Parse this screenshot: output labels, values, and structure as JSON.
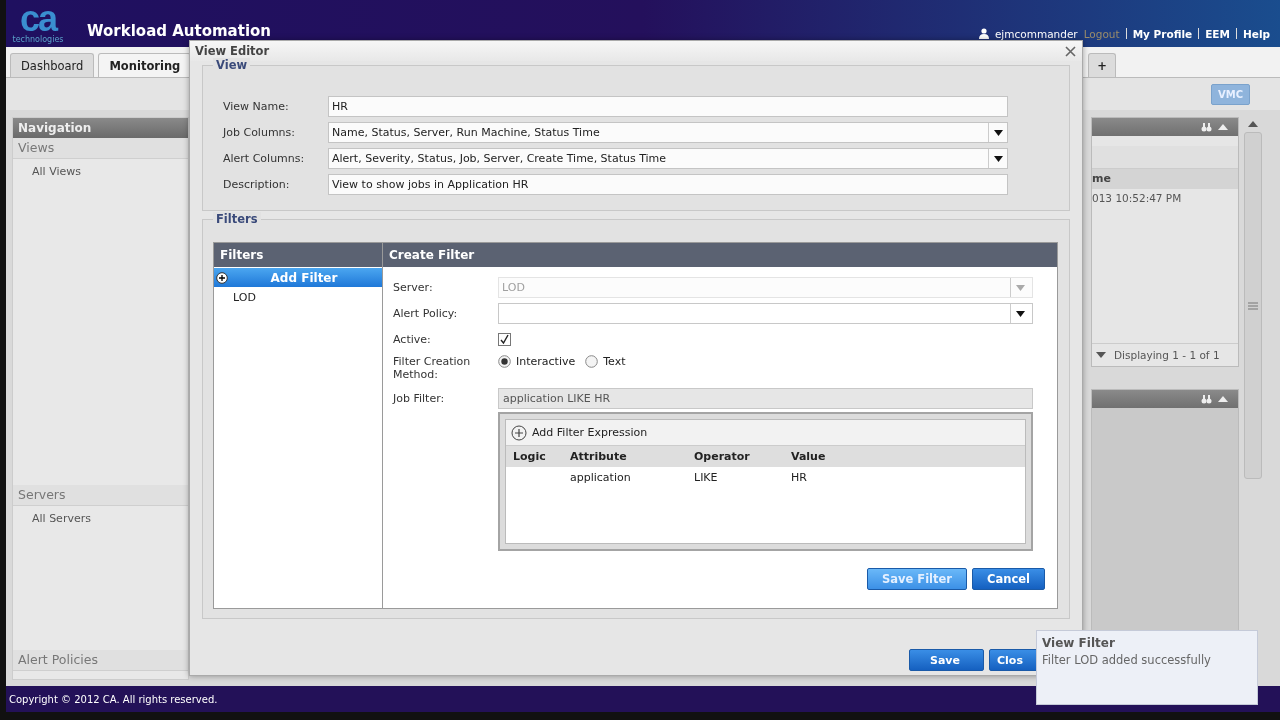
{
  "header": {
    "logo_mark": "ca",
    "logo_sub": "technologies",
    "title": "Workload Automation",
    "user": "ejmcommander",
    "logout": "Logout",
    "links": [
      "My Profile",
      "EEM",
      "Help"
    ]
  },
  "tabs": [
    {
      "label": "Dashboard",
      "selected": false
    },
    {
      "label": "Monitoring",
      "selected": true
    }
  ],
  "add_tab": "+",
  "toolbar_button": "VMC",
  "navigation": {
    "title": "Navigation",
    "sections": [
      {
        "title": "Views",
        "items": [
          "All Views"
        ]
      },
      {
        "title": "Servers",
        "items": [
          "All Servers"
        ]
      },
      {
        "title": "Alert Policies"
      }
    ]
  },
  "right_panel": {
    "column_header": "me",
    "cell": "013 10:52:47 PM",
    "pager": "Displaying 1 - 1 of 1"
  },
  "footer": {
    "copyright": "Copyright © 2012 CA. All rights reserved."
  },
  "dialog": {
    "title": "View Editor",
    "view_section": {
      "legend": "View",
      "fields": [
        {
          "label": "View Name:",
          "value": "HR",
          "kind": "text"
        },
        {
          "label": "Job Columns:",
          "value": "Name, Status, Server, Run Machine, Status Time",
          "kind": "dropdown"
        },
        {
          "label": "Alert Columns:",
          "value": "Alert, Severity, Status, Job, Server, Create Time, Status Time",
          "kind": "dropdown"
        },
        {
          "label": "Description:",
          "value": "View to show jobs in Application HR",
          "kind": "text"
        }
      ]
    },
    "filters_section": {
      "legend": "Filters",
      "list": {
        "title": "Filters",
        "add_button": "Add Filter",
        "items": [
          {
            "label": "LOD",
            "selected": false
          }
        ]
      },
      "create": {
        "title": "Create Filter",
        "server": {
          "label": "Server:",
          "value": "LOD",
          "disabled": true
        },
        "alert_policy": {
          "label": "Alert Policy:"
        },
        "active": {
          "label": "Active:",
          "checked": true
        },
        "method": {
          "label": "Filter Creation Method:",
          "options": [
            {
              "label": "Interactive",
              "selected": true
            },
            {
              "label": "Text",
              "selected": false
            }
          ]
        },
        "job_filter": {
          "label": "Job Filter:",
          "value": "application LIKE HR"
        },
        "expressions": {
          "add_button": "Add Filter Expression",
          "columns": [
            "Logic",
            "Attribute",
            "Operator",
            "Value"
          ],
          "rows": [
            {
              "attribute": "application",
              "operator": "LIKE",
              "value": "HR"
            }
          ]
        },
        "buttons": [
          "Save Filter",
          "Cancel"
        ]
      }
    },
    "buttons": [
      "Save",
      "Clos"
    ]
  },
  "toast": {
    "title": "View Filter",
    "message": "Filter LOD added successfully"
  }
}
